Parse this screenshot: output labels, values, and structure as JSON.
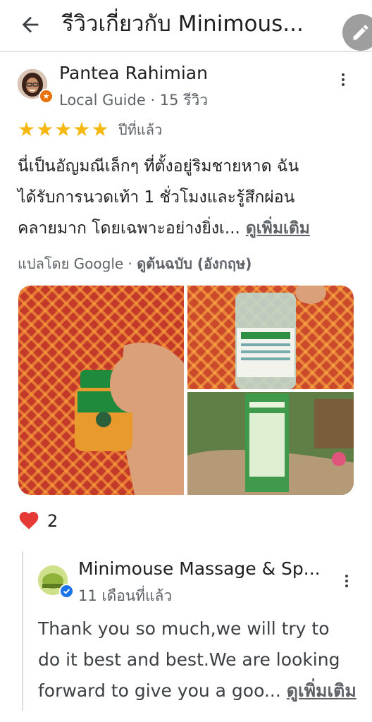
{
  "header": {
    "title": "รีวิวเกี่ยวกับ Minimous...",
    "back_icon": "arrow-left-icon",
    "edit_icon": "pencil-icon"
  },
  "review": {
    "reviewer_name": "Pantea Rahimian",
    "reviewer_meta": "Local Guide · 15 รีวิว",
    "rating": 5,
    "time": "ปีที่แล้ว",
    "text_lines": [
      "นี่เป็นอัญมณีเล็กๆ ที่ตั้งอยู่ริมชายหาด ฉัน",
      "ได้รับการนวดเท้า 1 ชั่วโมงและรู้สึกผ่อน",
      "คลายมาก โดยเฉพาะอย่างยิ่งเ..."
    ],
    "more_label": "ดูเพิ่มเติม",
    "translated_prefix": "แปลโดย Google · ",
    "translated_link": "ดูต้นฉบับ (อังกฤษ)",
    "likes": "2"
  },
  "owner_reply": {
    "name": "Minimouse Massage & Sp...",
    "time": "11 เดือนที่แล้ว",
    "text_lines": [
      "Thank you so much,we will try to",
      "do it best and best.We are looking",
      "forward to give you a goo..."
    ],
    "more_label": "ดูเพิ่มเติม"
  },
  "colors": {
    "star": "#f6b80f",
    "heart": "#e53935",
    "guide_badge": "#e8710a",
    "verified": "#1a73e8",
    "secondary_text": "#5f6368"
  }
}
